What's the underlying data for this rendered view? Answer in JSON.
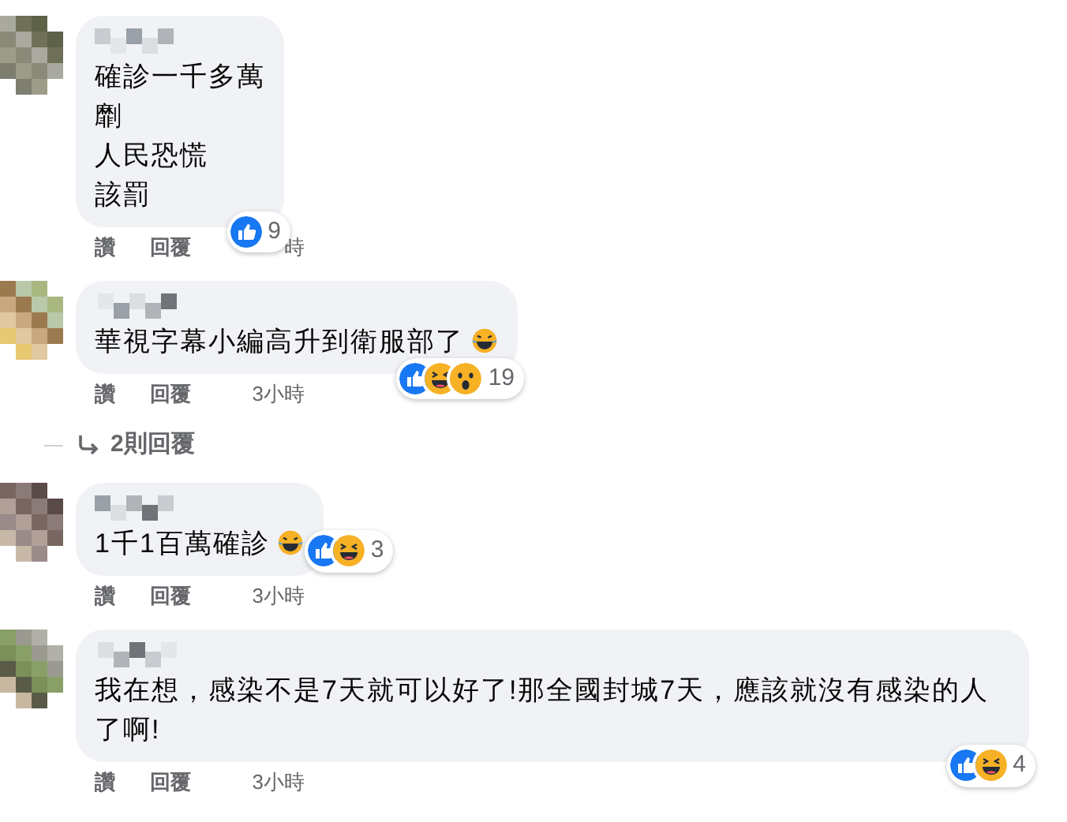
{
  "comments": [
    {
      "lines": [
        "確診一千多萬",
        "劘",
        "人民恐慌",
        "該罰"
      ],
      "trailing_emoji": false,
      "reactions": [
        {
          "kind": "like"
        }
      ],
      "reaction_count": "9",
      "actions": [
        "讚",
        "回覆"
      ],
      "time": "時"
    },
    {
      "lines": [
        "華視字幕小編高升到衛服部了"
      ],
      "trailing_emoji": true,
      "reactions": [
        {
          "kind": "like"
        },
        {
          "kind": "haha"
        },
        {
          "kind": "wow"
        }
      ],
      "reaction_count": "19",
      "actions": [
        "讚",
        "回覆"
      ],
      "time": "3小時",
      "replies_link": "2則回覆"
    },
    {
      "lines": [
        "1千1百萬確診"
      ],
      "trailing_emoji": true,
      "reactions": [
        {
          "kind": "like"
        },
        {
          "kind": "haha"
        }
      ],
      "reaction_count": "3",
      "actions": [
        "讚",
        "回覆"
      ],
      "time": "3小時"
    },
    {
      "lines": [
        "我在想，感染不是7天就可以好了!那全國封城7天，應該就沒有感染的人了啊!"
      ],
      "trailing_emoji": false,
      "reactions": [
        {
          "kind": "like"
        },
        {
          "kind": "haha"
        }
      ],
      "reaction_count": "4",
      "actions": [
        "讚",
        "回覆"
      ],
      "time": "3小時"
    }
  ]
}
